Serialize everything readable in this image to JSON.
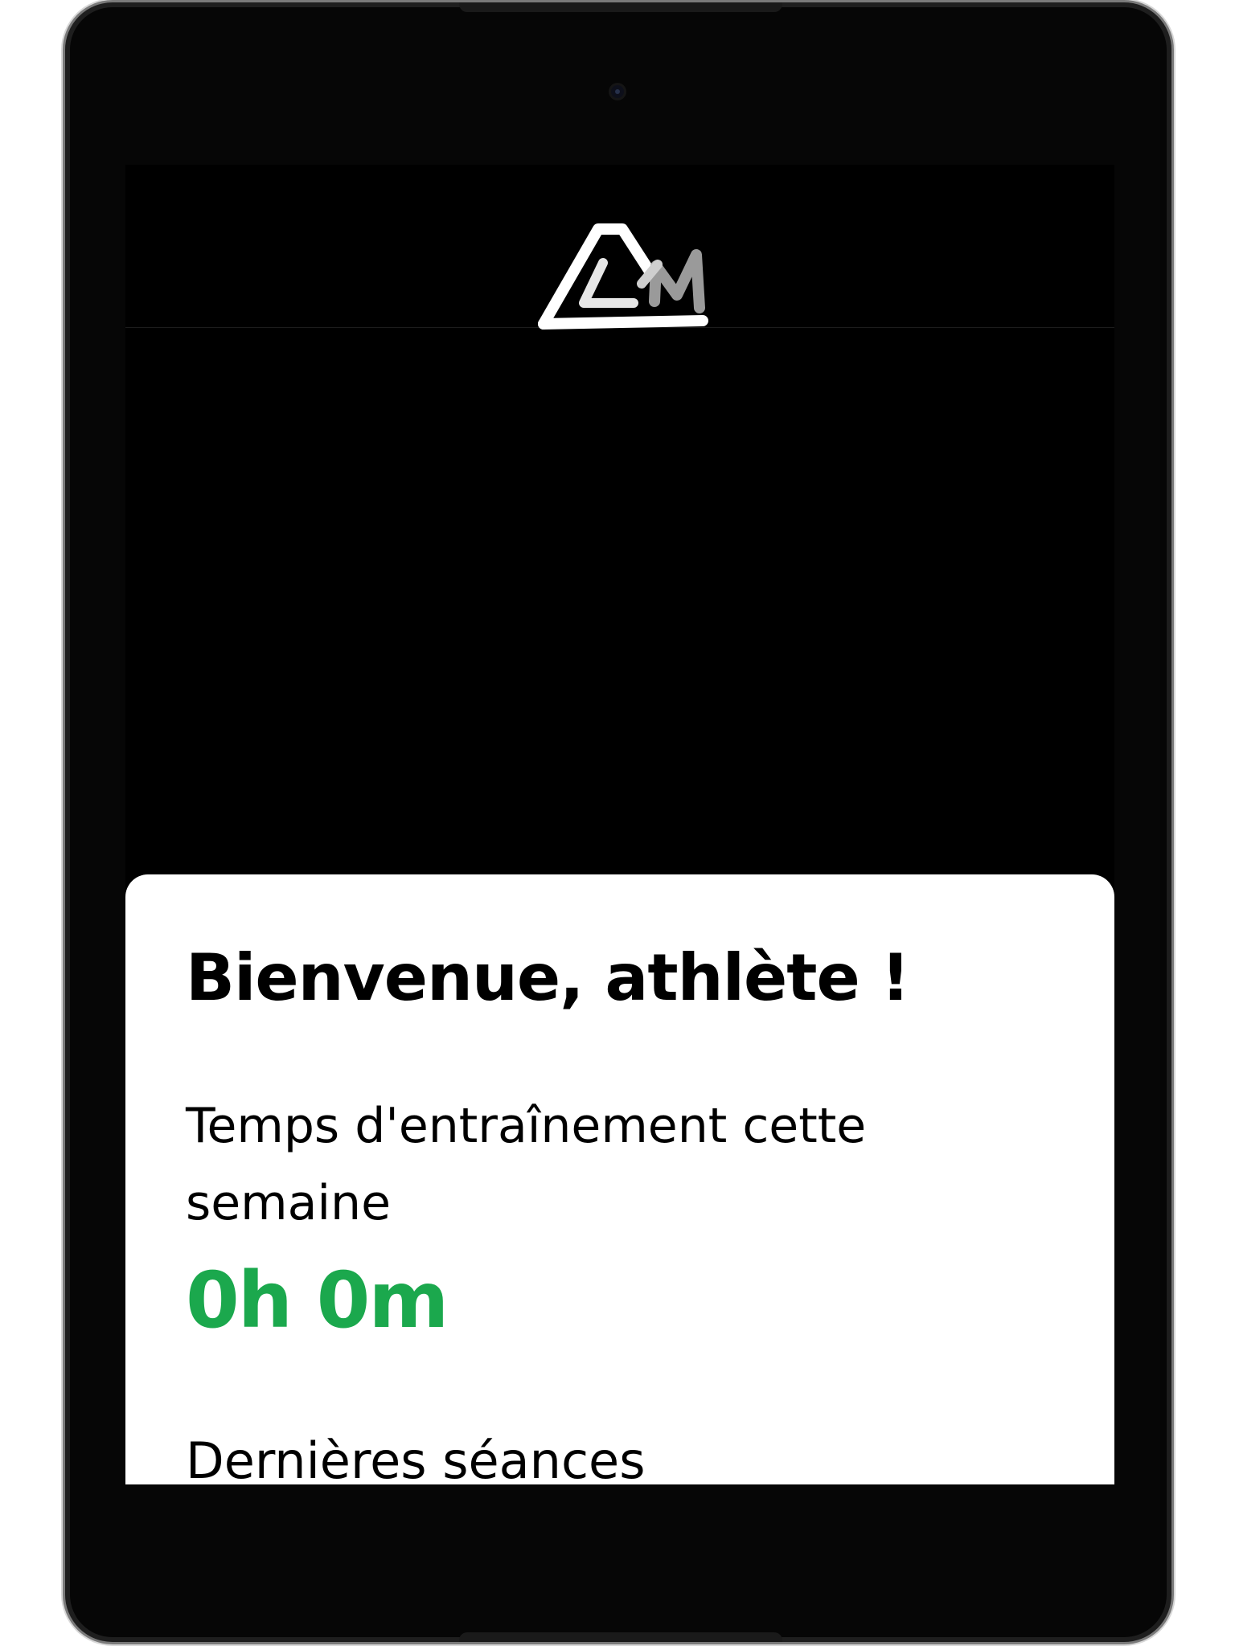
{
  "header": {
    "logo_icon": "brand-mountain-logo-icon"
  },
  "card": {
    "welcome": "Bienvenue, athlète !",
    "time_label": "Temps d'entraînement cette semaine",
    "time_value": "0h 0m",
    "recent_title": "Dernières séances"
  },
  "colors": {
    "accent": "#1ba84d",
    "background": "#000000",
    "card": "#ffffff"
  }
}
